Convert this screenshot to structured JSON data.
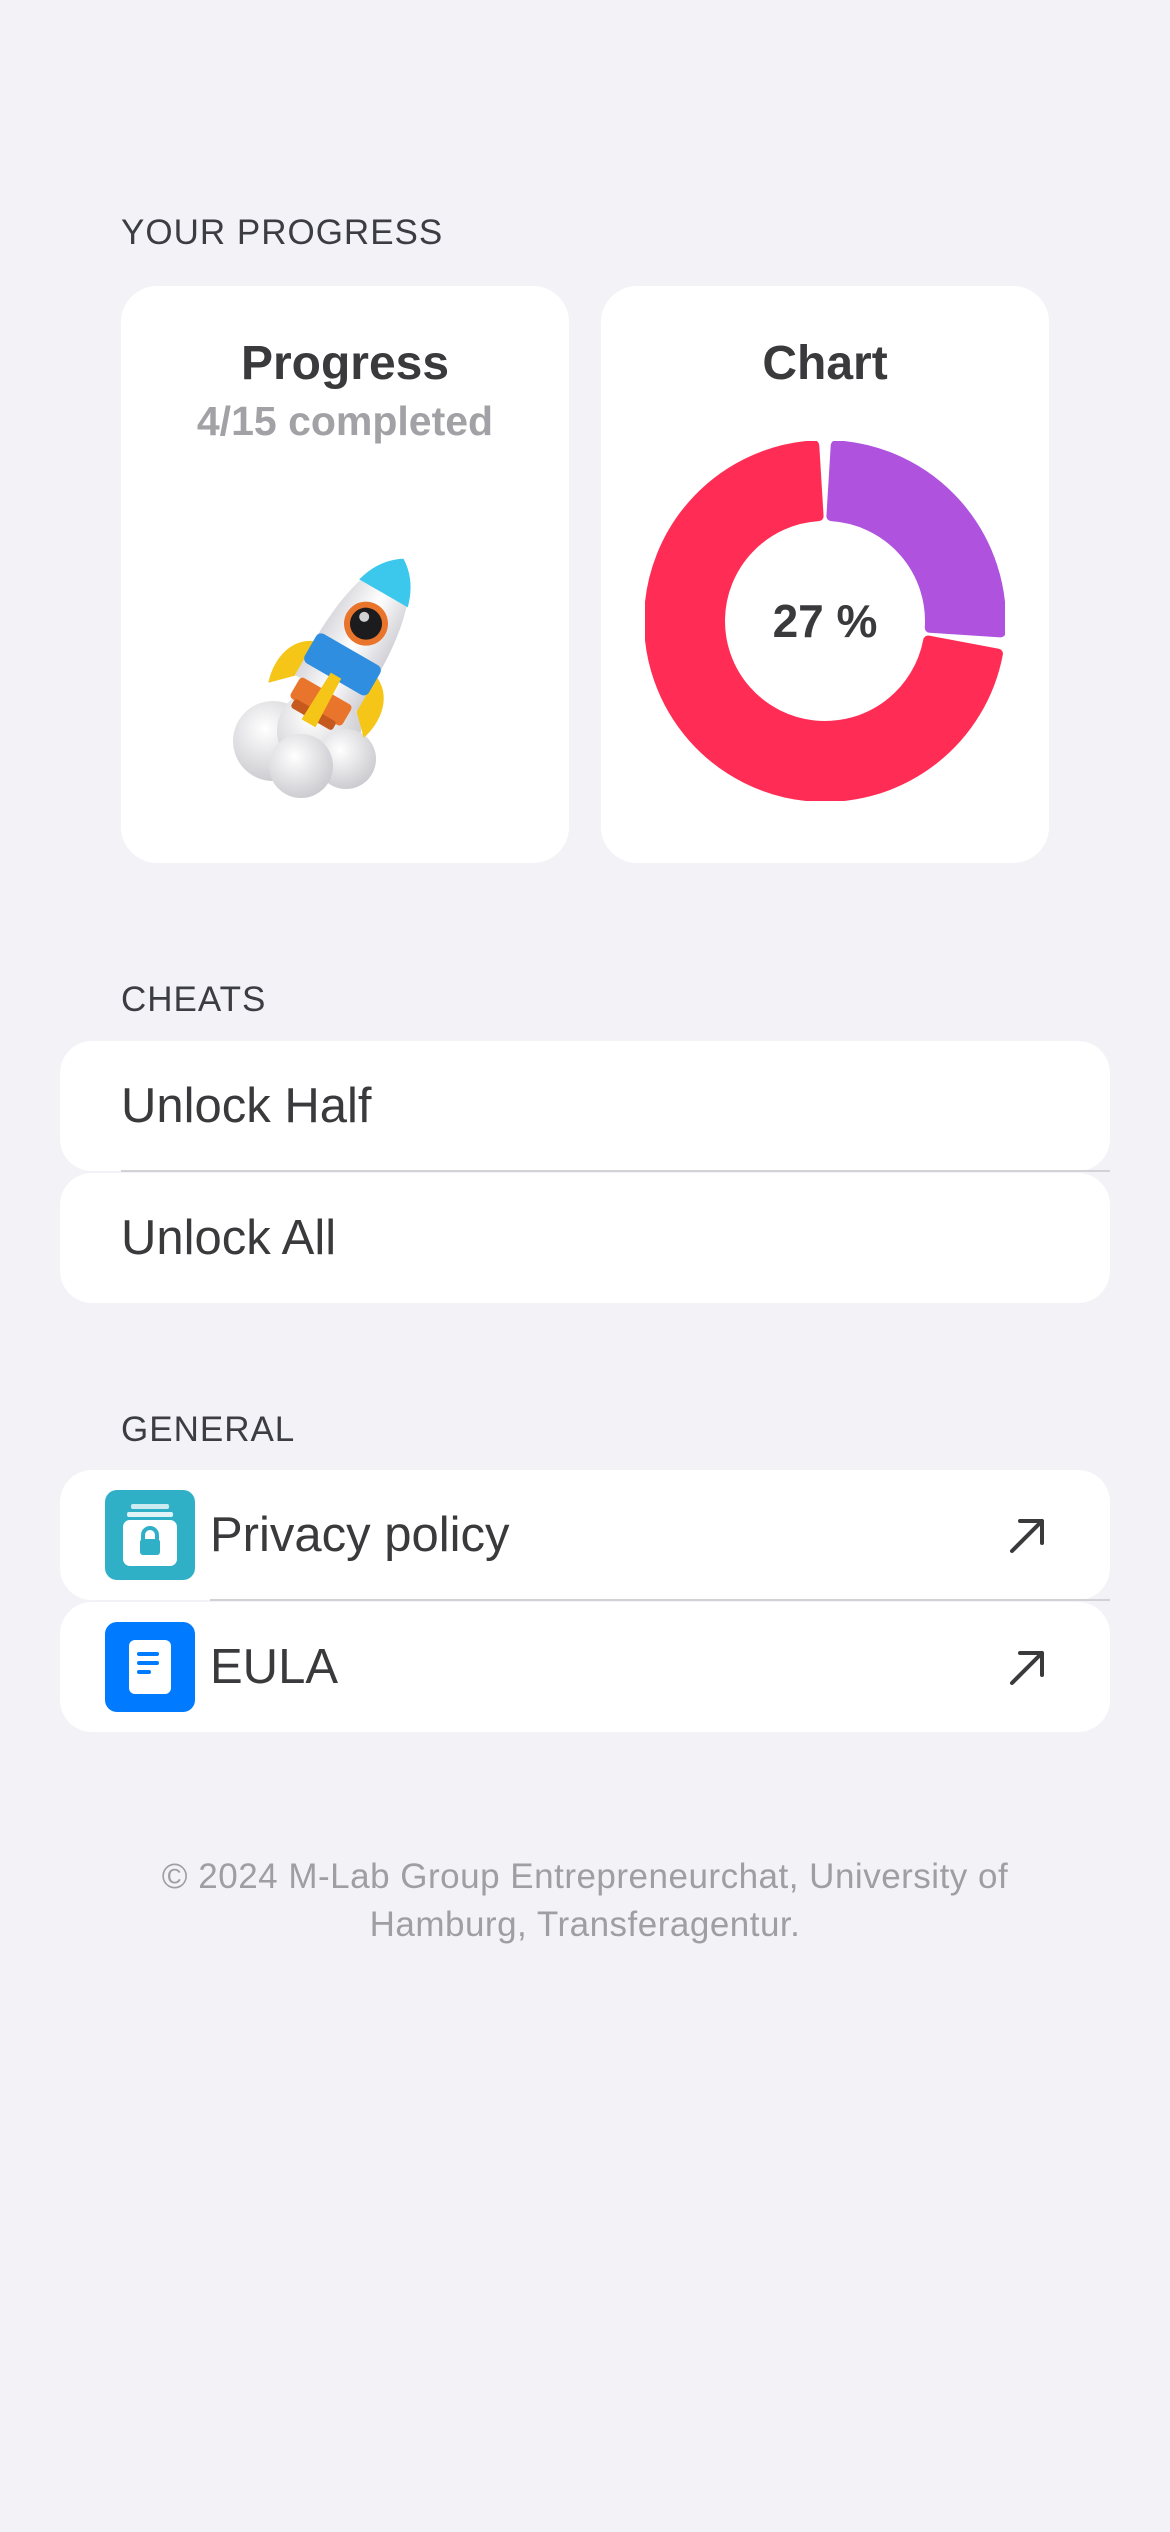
{
  "progress_section": {
    "header": "YOUR PROGRESS",
    "progress_card": {
      "title": "Progress",
      "subtitle": "4/15 completed",
      "illustration": "rocket-illustration"
    },
    "chart_card": {
      "title": "Chart",
      "center_label": "27 %"
    }
  },
  "chart_data": {
    "type": "pie",
    "style": "donut",
    "title": "Chart",
    "center_label": "27 %",
    "slices": [
      {
        "value": 27,
        "color": "#AF52DE"
      },
      {
        "value": 73,
        "color": "#FF2D55"
      }
    ]
  },
  "cheats_section": {
    "header": "CHEATS",
    "items": [
      {
        "label": "Unlock Half"
      },
      {
        "label": "Unlock All"
      }
    ]
  },
  "general_section": {
    "header": "GENERAL",
    "items": [
      {
        "label": "Privacy policy",
        "icon": "lock-icon",
        "icon_color": "#30B0C7",
        "trailing_icon": "arrow-up-right-icon"
      },
      {
        "label": "EULA",
        "icon": "document-icon",
        "icon_color": "#007AFF",
        "trailing_icon": "arrow-up-right-icon"
      }
    ]
  },
  "footer": {
    "text": "© 2024 M-Lab Group Entrepreneurchat, University of Hamburg, Transferagentur."
  },
  "colors": {
    "background": "#F2F2F7",
    "card": "#FFFFFF",
    "donut_primary": "#FF2D55",
    "donut_progress": "#AF52DE",
    "privacy_icon": "#30B0C7",
    "eula_icon": "#007AFF"
  }
}
